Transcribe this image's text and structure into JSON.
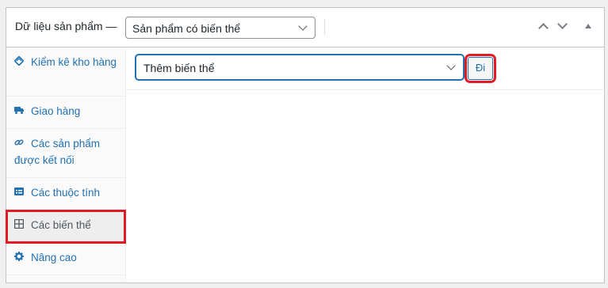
{
  "header": {
    "title": "Dữ liệu sản phẩm —",
    "product_type": "Sản phẩm có biến thể",
    "buttons": [
      "move-up",
      "move-down",
      "toggle-panel"
    ]
  },
  "tabs": [
    {
      "label": "Kiểm kê kho hàng",
      "icon": "inventory-icon"
    },
    {
      "label": "Giao hàng",
      "icon": "truck-icon"
    },
    {
      "label": "Các sản phẩm được kết nối",
      "icon": "link-icon"
    },
    {
      "label": "Các thuộc tính",
      "icon": "list-icon"
    },
    {
      "label": "Các biến thể",
      "icon": "grid-icon",
      "active": true
    },
    {
      "label": "Nâng cao",
      "icon": "gear-icon"
    }
  ],
  "variations": {
    "action": "Thêm biến thể",
    "go_label": "Đi"
  },
  "colors": {
    "link": "#2271b1",
    "highlight": "#e01b24"
  }
}
